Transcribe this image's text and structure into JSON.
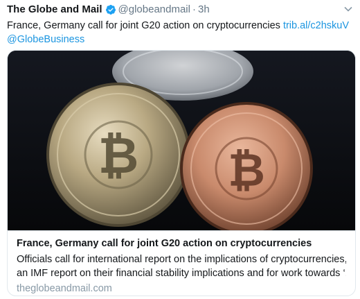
{
  "author": {
    "name": "The Globe and Mail",
    "handle": "@globeandmail",
    "separator": "·",
    "time": "3h"
  },
  "tweet": {
    "text": "France, Germany call for joint G20 action on cryptocurrencies",
    "link": "trib.al/c2hskuV",
    "mention": "@GlobeBusiness"
  },
  "card": {
    "image_icon": "bitcoin-coins-photo",
    "title": "France, Germany call for joint G20 action on cryptocurrencies",
    "description_line1": "Officials call for international report on the implications of cryptocurrencies,",
    "description_line2": "an IMF report on their financial stability implications and for work towards ‘...",
    "domain": "theglobeandmail.com"
  },
  "colors": {
    "link": "#1b95e0",
    "verified": "#1da1f2",
    "muted": "#657786",
    "border": "#e1e8ed"
  }
}
